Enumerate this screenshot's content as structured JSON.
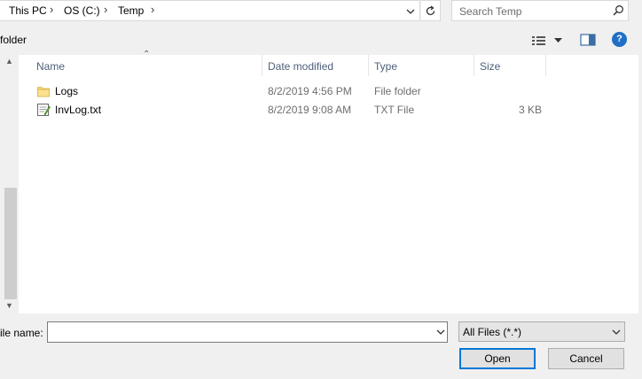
{
  "address_bar": {
    "breadcrumbs": [
      "This PC",
      "OS (C:)",
      "Temp"
    ],
    "dropdown_icon": "chevron-down-icon",
    "refresh_icon": "refresh-icon"
  },
  "search": {
    "placeholder": "Search Temp",
    "icon": "search-icon"
  },
  "toolbar": {
    "new_folder_label": "folder",
    "view_icon": "details-view-icon",
    "preview_icon": "preview-pane-icon",
    "help_label": "?"
  },
  "file_list": {
    "columns": [
      "Name",
      "Date modified",
      "Type",
      "Size"
    ],
    "sort_column": "Name",
    "rows": [
      {
        "name": "Logs",
        "date": "8/2/2019 4:56 PM",
        "type": "File folder",
        "size": "",
        "icon": "folder-icon"
      },
      {
        "name": "InvLog.txt",
        "date": "8/2/2019 9:08 AM",
        "type": "TXT File",
        "size": "3 KB",
        "icon": "text-file-icon"
      }
    ]
  },
  "footer": {
    "filename_label": "ile name:",
    "filename_value": "",
    "filetype_value": "All Files (*.*)",
    "open_label": "Open",
    "cancel_label": "Cancel"
  },
  "colors": {
    "accent": "#0078d7",
    "header_text": "#4c607a",
    "help_blue": "#1f6fc5",
    "folder_yellow": "#f8d775"
  }
}
